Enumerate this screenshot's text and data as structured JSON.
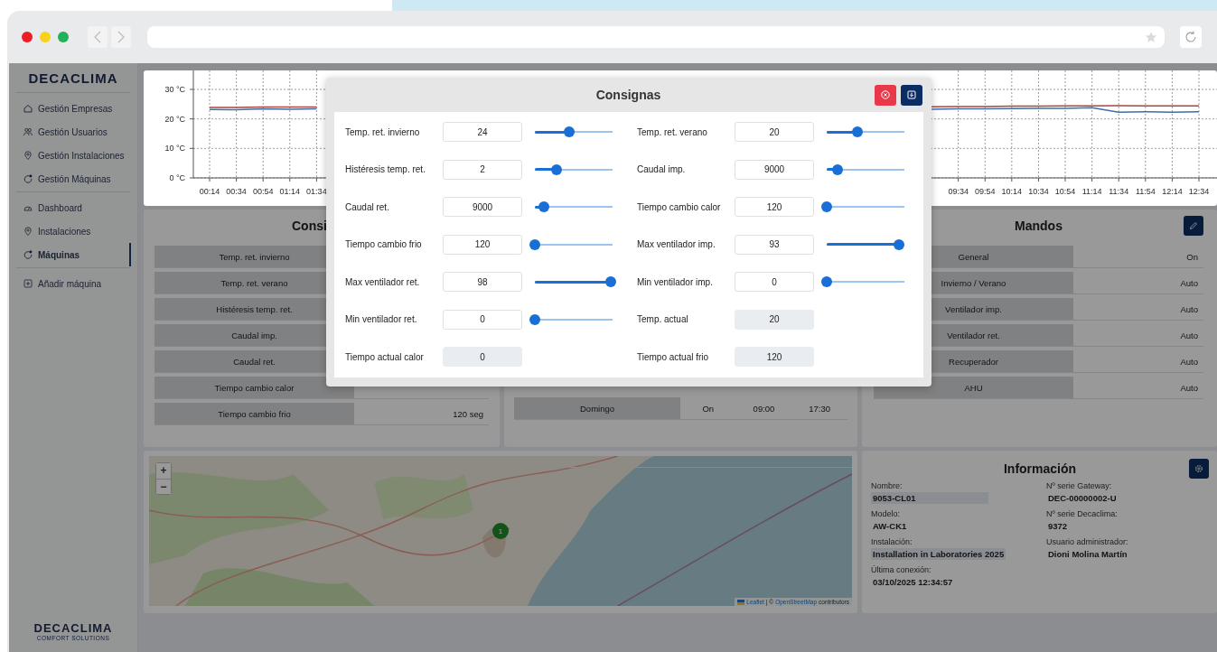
{
  "sidebar": {
    "logo": "DECACLIMA",
    "groups": [
      [
        {
          "label": "Gestión Empresas",
          "kind": "home",
          "selected": false
        },
        {
          "label": "Gestión Usuarios",
          "kind": "users",
          "selected": false
        },
        {
          "label": "Gestión Instalaciones",
          "kind": "pin",
          "selected": false
        },
        {
          "label": "Gestión Máquinas",
          "kind": "machine",
          "selected": false
        }
      ],
      [
        {
          "label": "Dashboard",
          "kind": "gauge",
          "selected": false
        },
        {
          "label": "Instalaciones",
          "kind": "pin",
          "selected": false
        },
        {
          "label": "Máquinas",
          "kind": "machine",
          "selected": true
        }
      ],
      [
        {
          "label": "Añadir máquina",
          "kind": "add",
          "selected": false
        }
      ]
    ],
    "footer_logo": "DECACLIMA",
    "footer_tagline": "COMFORT SOLUTIONS"
  },
  "chart": {
    "chart_data": {
      "type": "line",
      "categories": [
        "00:14",
        "00:34",
        "00:54",
        "01:14",
        "01:34",
        null,
        null,
        null,
        null,
        null,
        null,
        null,
        null,
        null,
        null,
        null,
        null,
        null,
        null,
        null,
        null,
        null,
        null,
        null,
        null,
        null,
        null,
        null,
        "09:34",
        "09:54",
        "10:14",
        "10:34",
        "10:54",
        "11:14",
        "11:34",
        "11:54",
        "12:14",
        "12:34"
      ],
      "series": [
        {
          "color": "#a9463e",
          "values": [
            23.9,
            23.9,
            24,
            24,
            24,
            null,
            null,
            null,
            null,
            null,
            null,
            null,
            null,
            null,
            null,
            null,
            null,
            null,
            null,
            null,
            null,
            null,
            null,
            null,
            null,
            null,
            null,
            24.1,
            24.2,
            24.2,
            24.3,
            24.3,
            24.4,
            24.4,
            24.5,
            24.4,
            24.4,
            24.4
          ]
        },
        {
          "color": "#3d6fa8",
          "values": [
            23.2,
            23.1,
            23.4,
            23.3,
            23.4,
            null,
            null,
            null,
            null,
            null,
            null,
            null,
            null,
            null,
            null,
            null,
            null,
            null,
            null,
            null,
            null,
            null,
            null,
            null,
            null,
            null,
            null,
            23.3,
            23.4,
            23.4,
            23.5,
            23.6,
            23.6,
            23.8,
            22.3,
            22.4,
            22.3,
            22.4
          ]
        }
      ],
      "ylim": [
        0,
        30
      ],
      "grid": true,
      "yticks": [
        {
          "value": 0,
          "label": "0 °C"
        },
        {
          "value": 10,
          "label": "10 °C"
        },
        {
          "value": 20,
          "label": "20 °C"
        },
        {
          "value": 30,
          "label": "30 °C"
        }
      ]
    }
  },
  "setpoints_card": {
    "title": "Consi",
    "rows": [
      {
        "label": "Temp. ret. invierno"
      },
      {
        "label": "Temp. ret. verano"
      },
      {
        "label": "Histéresis temp. ret."
      },
      {
        "label": "Caudal imp."
      },
      {
        "label": "Caudal ret."
      },
      {
        "label": "Tiempo cambio calor"
      },
      {
        "label": "Tiempo cambio frio",
        "value": "120 seg"
      }
    ]
  },
  "schedule_card": {
    "rows": [
      {
        "day": "Domingo",
        "state": "On",
        "start": "09:00",
        "end": "17:30"
      }
    ]
  },
  "controls_card": {
    "title": "Mandos",
    "rows": [
      {
        "label": "General",
        "value": "On"
      },
      {
        "label": "Invierno / Verano",
        "value": "Auto"
      },
      {
        "label": "Ventilador imp.",
        "value": "Auto"
      },
      {
        "label": "Ventilador ret.",
        "value": "Auto"
      },
      {
        "label": "Recuperador",
        "value": "Auto"
      },
      {
        "label": "AHU",
        "value": "Auto"
      }
    ]
  },
  "map": {
    "zoom_in": "+",
    "zoom_out": "−",
    "marker": "1",
    "attribution": [
      {
        "text": "Leaflet",
        "link": true
      },
      {
        "text": "| ©",
        "link": false
      },
      {
        "text": "OpenStreetMap",
        "link": true
      },
      {
        "text": "contributors",
        "link": false
      }
    ]
  },
  "info_card": {
    "title": "Información",
    "fields": [
      {
        "label": "Nombre:",
        "value": "9053-CL01",
        "highlighted": true
      },
      {
        "label": "Nº serie Gateway:",
        "value": "DEC-00000002-U",
        "highlighted": false
      },
      {
        "label": "Modelo:",
        "value": "AW-CK1",
        "highlighted": false
      },
      {
        "label": "Nº serie Decaclima:",
        "value": "9372",
        "highlighted": false
      },
      {
        "label": "Instalación:",
        "value": "Installation in Laboratories 2025",
        "highlighted": true
      },
      {
        "label": "Usuario administrador:",
        "value": "Dioni Molina Martín",
        "highlighted": false
      },
      {
        "label": "Última conexión:",
        "value": "03/10/2025 12:34:57",
        "highlighted": false
      }
    ]
  },
  "modal": {
    "title": "Consignas",
    "rows": [
      {
        "label": "Temp. ret. invierno",
        "value": "24",
        "kind": "slider",
        "level": 0.44
      },
      {
        "label": "Temp. ret. verano",
        "value": "20",
        "kind": "slider",
        "level": 0.4
      },
      {
        "label": "Histéresis temp. ret.",
        "value": "2",
        "kind": "slider",
        "level": 0.28
      },
      {
        "label": "Caudal imp.",
        "value": "9000",
        "kind": "slider",
        "level": 0.14
      },
      {
        "label": "Caudal ret.",
        "value": "9000",
        "kind": "slider",
        "level": 0.12
      },
      {
        "label": "Tiempo cambio calor",
        "value": "120",
        "kind": "slider",
        "level": 0
      },
      {
        "label": "Tiempo cambio frio",
        "value": "120",
        "kind": "slider",
        "level": 0
      },
      {
        "label": "Max ventilador imp.",
        "value": "93",
        "kind": "slider",
        "level": 0.93
      },
      {
        "label": "Max ventilador ret.",
        "value": "98",
        "kind": "slider",
        "level": 0.98
      },
      {
        "label": "Min ventilador imp.",
        "value": "0",
        "kind": "slider",
        "level": 0
      },
      {
        "label": "Min ventilador ret.",
        "value": "0",
        "kind": "slider",
        "level": 0
      },
      {
        "label": "Temp. actual",
        "value": "20",
        "kind": "readonly"
      },
      {
        "label": "Tiempo actual calor",
        "value": "0",
        "kind": "readonly"
      },
      {
        "label": "Tiempo actual frio",
        "value": "120",
        "kind": "readonly"
      }
    ]
  }
}
